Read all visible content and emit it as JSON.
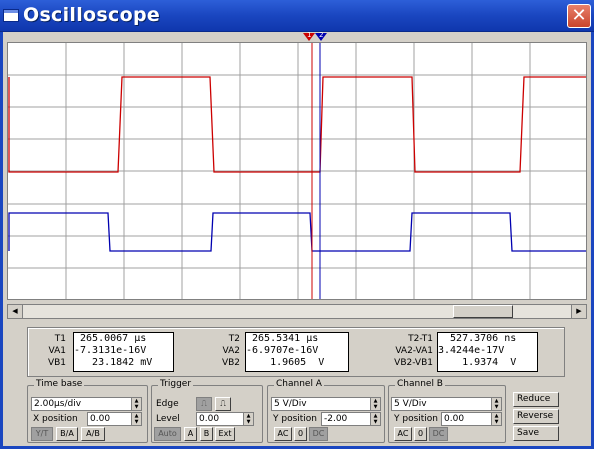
{
  "window": {
    "title": "Oscilloscope",
    "close_glyph": "✕"
  },
  "cursors": {
    "t1_marker": "1",
    "t2_marker": "2"
  },
  "readout": {
    "col1": {
      "labels": [
        "T1",
        "VA1",
        "VB1"
      ],
      "values": [
        " 265.0067 μs",
        "-7.3131e-16V",
        "   23.1842 mV"
      ]
    },
    "col2": {
      "labels": [
        "T2",
        "VA2",
        "VB2"
      ],
      "values": [
        " 265.5341 μs",
        "-6.9707e-16V",
        "    1.9605  V"
      ]
    },
    "col3": {
      "labels": [
        "T2-T1",
        "VA2-VA1",
        "VB2-VB1"
      ],
      "values": [
        "  527.3706 ns",
        "3.4244e-17V",
        "    1.9374  V"
      ]
    }
  },
  "timebase": {
    "title": "Time base",
    "scale": "2.00μs/div",
    "xpos_label": "X position",
    "xpos": "0.00",
    "modes": [
      "Y/T",
      "B/A",
      "A/B"
    ]
  },
  "trigger": {
    "title": "Trigger",
    "edge_label": "Edge",
    "level_label": "Level",
    "level": "0.00",
    "sources": [
      "Auto",
      "A",
      "B",
      "Ext"
    ]
  },
  "channel_a": {
    "title": "Channel A",
    "scale": "5 V/Div",
    "ypos_label": "Y position",
    "ypos": "-2.00",
    "coupling": [
      "AC",
      "0",
      "DC"
    ]
  },
  "channel_b": {
    "title": "Channel B",
    "scale": "5 V/Div",
    "ypos_label": "Y position",
    "ypos": "0.00",
    "coupling": [
      "AC",
      "0",
      "DC"
    ]
  },
  "actions": [
    "Reduce",
    "Reverse",
    "Save"
  ],
  "colors": {
    "channel_a": "#cc0000",
    "channel_b": "#0000b0",
    "grid": "#a0a0a0"
  }
}
